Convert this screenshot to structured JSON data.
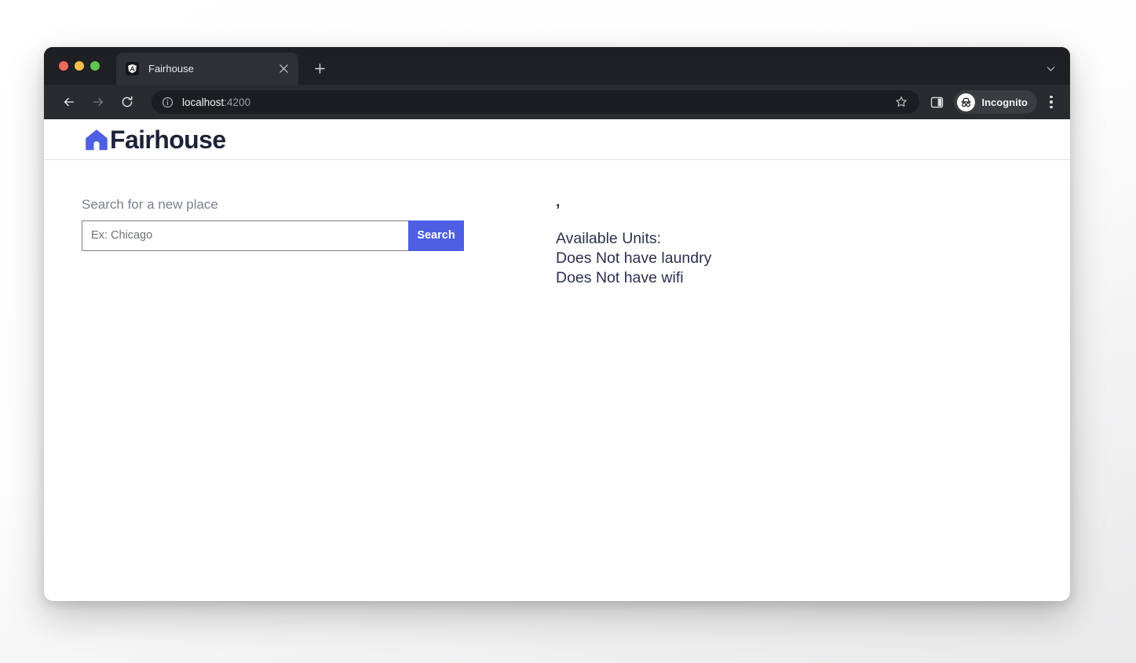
{
  "browser": {
    "traffic_lights": [
      "close",
      "minimize",
      "maximize"
    ],
    "tab": {
      "title": "Fairhouse",
      "favicon": "angular-icon",
      "close_icon": "close-icon"
    },
    "new_tab_icon": "plus-icon",
    "tab_search_icon": "chevron-down-icon",
    "toolbar": {
      "back_icon": "arrow-left-icon",
      "forward_icon": "arrow-right-icon",
      "reload_icon": "reload-icon",
      "info_icon": "info-circle-icon",
      "url_host": "localhost",
      "url_port": ":4200",
      "bookmark_icon": "star-icon",
      "side_panel_icon": "side-panel-icon",
      "profile": {
        "icon": "incognito-icon",
        "label": "Incognito"
      },
      "menu_icon": "three-dots-icon"
    }
  },
  "site": {
    "brand": {
      "logo_icon": "house-icon",
      "name": "Fairhouse",
      "logo_color": "#4e5fe3",
      "text_color": "#1d2238"
    },
    "search": {
      "label": "Search for a new place",
      "input_value": "",
      "placeholder": "Ex: Chicago",
      "button_label": "Search",
      "button_color": "#4e5fe3"
    },
    "results": {
      "meta": ",",
      "lines": [
        "Available Units:",
        "Does Not have laundry",
        "Does Not have wifi"
      ]
    }
  }
}
